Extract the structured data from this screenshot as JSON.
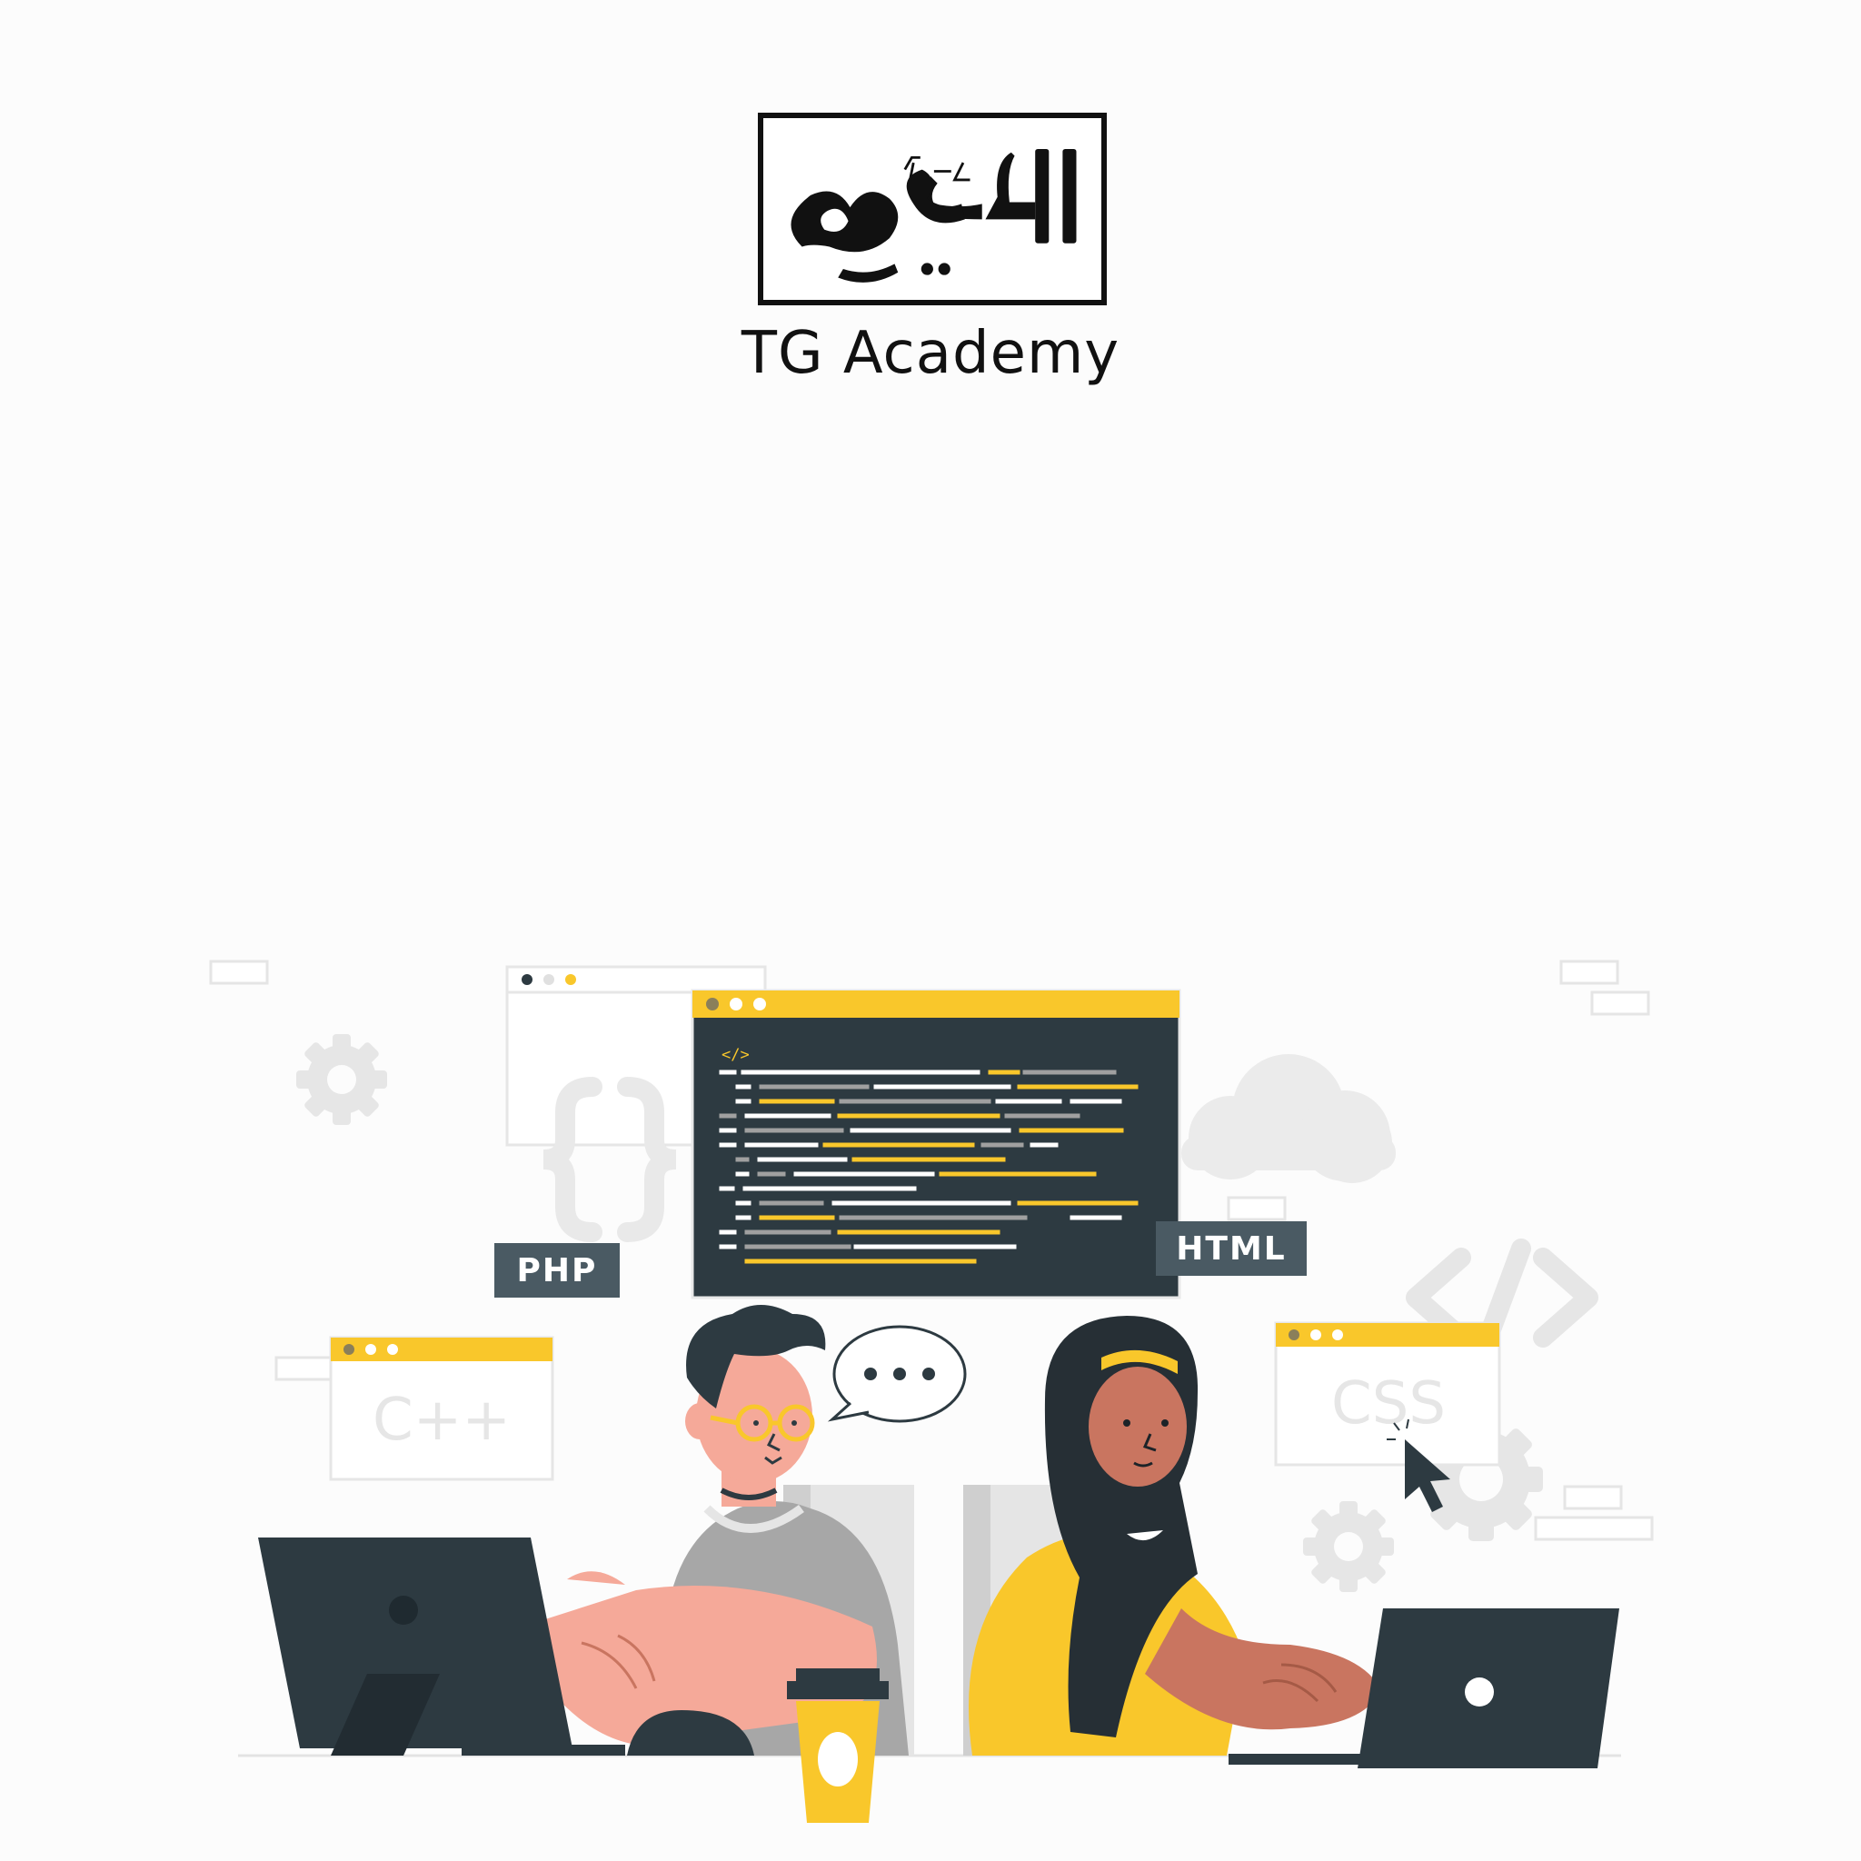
{
  "brand": {
    "logo_text": "اللعبة",
    "logo_small": "ゲーム",
    "name": "TG Academy"
  },
  "illustration": {
    "labels": {
      "php": "PHP",
      "html": "HTML",
      "cpp": "C++",
      "css": "CSS",
      "code_tag": "</>"
    },
    "colors": {
      "yellow": "#f9c72b",
      "dark": "#2d3a41",
      "slate": "#4a5a63",
      "skin_light": "#f5a999",
      "skin_dark": "#c97560",
      "shirt_gray": "#a7a7a7",
      "light_gray": "#ececec"
    }
  }
}
